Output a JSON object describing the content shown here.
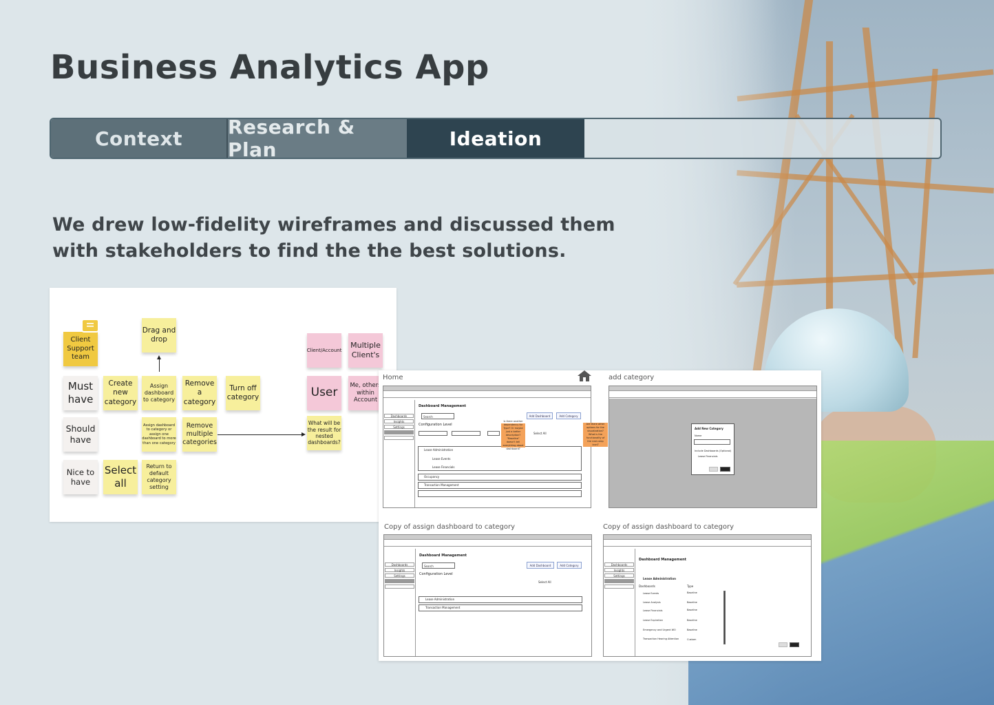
{
  "title": "Business Analytics App",
  "tabs": [
    {
      "label": "Context"
    },
    {
      "label": "Research & Plan"
    },
    {
      "label": "Ideation"
    }
  ],
  "description": [
    "We drew low-fidelity wireframes and discussed them",
    "with stakeholders to find the the best solutions."
  ],
  "board": {
    "stickies": {
      "client_support": "Client Support team",
      "drag_drop": "Drag and drop",
      "client_account": "Client/Account",
      "multiple_clients": "Multiple Client's",
      "must_have": "Must have",
      "create_category": "Create new category",
      "assign_dashboard": "Assign dashboard to category",
      "remove_category": "Remove a category",
      "turn_off": "Turn off category",
      "user": "User",
      "me_others": "Me, others within Account",
      "should_have": "Should have",
      "assign_more": "Assign dashboard to category or assign one dashboard to more than one category",
      "remove_multiple": "Remove multiple categories",
      "nested_result": "What will be the result for nested dashboards?",
      "nice_to_have": "Nice to have",
      "select_all": "Select all",
      "return_default": "Return to default category setting"
    }
  },
  "wireframes": {
    "labels": {
      "home": "Home",
      "add_category": "add category",
      "copy1": "Copy of assign dashboard to category",
      "copy2": "Copy of assign dashboard to category"
    },
    "dashboard_management": "Dashboard Management",
    "search": "Search",
    "add_dashboard": "Add Dashboard",
    "add_category": "Add Category",
    "configuration_level": "Configuration Level",
    "select_all": "Select All",
    "sidebar": [
      "Dashboards",
      "Insights",
      "Settings"
    ],
    "rows": [
      "Lease Administration",
      "Occupancy",
      "Transaction Management"
    ],
    "sub_rows": [
      "Lease Events",
      "Lease Financials"
    ],
    "note1": "Is there another dependency for Type? Or maybe just a better description? \"Baseline\" doesn't tell everything about dashboard?",
    "note2": "Are there other options for the visualization? What is the functionality of the next-step icon?",
    "modal_title": "Add New Category",
    "modal_name": "Name",
    "modal_include": "Include Dashboards (Optional)",
    "modal_option": "Lease Financials",
    "lease_admin": "Lease Administration",
    "detail_headers": [
      "Dashboards",
      "Type"
    ],
    "detail_rows": [
      {
        "name": "Lease Events",
        "type": "Baseline"
      },
      {
        "name": "Lease Analysis",
        "type": "Baseline"
      },
      {
        "name": "Lease Financials",
        "type": "Baseline"
      },
      {
        "name": "Lease Expiration",
        "type": "Baseline"
      },
      {
        "name": "Emergency and Urgent WO",
        "type": "Baseline"
      },
      {
        "name": "Transaction Hearing Attention",
        "type": "Custom"
      }
    ]
  },
  "colors": {
    "tab_active": "#2e4450",
    "tab_inactive": "#5d7079",
    "sticky_yellow": "#f7ef9c",
    "sticky_orange": "#f0c941",
    "sticky_pink": "#f4c8d8"
  }
}
